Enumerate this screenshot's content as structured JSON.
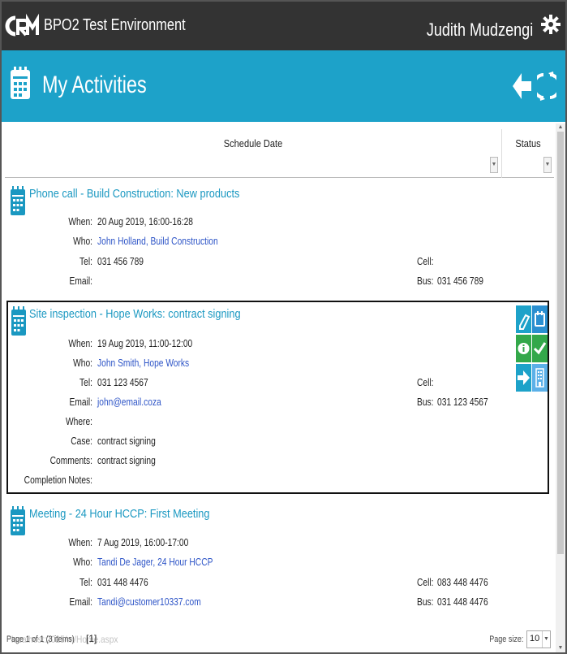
{
  "topbar": {
    "app_title": "BPO2 Test Environment",
    "user_name": "Judith Mudzengi"
  },
  "header": {
    "title": "My Activities"
  },
  "columns": {
    "schedule_date": "Schedule Date",
    "status": "Status",
    "filter_glyph": "▼"
  },
  "labels": {
    "when": "When:",
    "who": "Who:",
    "tel": "Tel:",
    "email": "Email:",
    "cell": "Cell:",
    "bus": "Bus:",
    "where": "Where:",
    "case": "Case:",
    "comments": "Comments:",
    "completion_notes": "Completion Notes:"
  },
  "activities": [
    {
      "title": "Phone call - Build Construction: New products",
      "when": "20 Aug 2019, 16:00-16:28",
      "who": "John Holland, Build Construction",
      "tel": "031 456 789",
      "email": "",
      "cell": "",
      "bus": "031 456 789"
    },
    {
      "title": "Site inspection - Hope Works: contract signing",
      "when": "19 Aug 2019, 11:00-12:00",
      "who": "John Smith, Hope Works",
      "tel": "031 123 4567",
      "email": "john@email.coza",
      "cell": "",
      "bus": "031 123 4567",
      "where": "",
      "case": "contract signing",
      "comments": "contract signing",
      "completion_notes": ""
    },
    {
      "title": "Meeting - 24 Hour HCCP: First Meeting",
      "when": "7 Aug 2019, 16:00-17:00",
      "who": "Tandi De Jager, 24 Hour HCCP",
      "tel": "031 448 4476",
      "email": "Tandi@customer10337.com",
      "cell": "083 448 4476",
      "bus": "031 448 4476"
    }
  ],
  "footer": {
    "pager_text": "Page 1 of 1 (3 items)",
    "current_page": "[1]",
    "url_ghost": "localhost:2025/m/Home.aspx",
    "page_size_label": "Page size:",
    "page_size": "10",
    "dropdown_glyph": "▼"
  },
  "colors": {
    "topbar": "#333333",
    "header": "#1da2c9",
    "title_link": "#1a98c1",
    "link": "#2e55c7",
    "green": "#33a84a"
  },
  "icons": {
    "logo": "crm-logo",
    "gear": "gear-icon",
    "calendar": "calendar-icon",
    "back": "back-arrow-icon",
    "refresh": "refresh-icon",
    "edit": "pencil-icon",
    "schedule": "calendar-icon",
    "info": "info-icon",
    "complete": "check-icon",
    "forward": "arrow-right-icon",
    "building": "building-icon"
  },
  "scrollbar": {
    "up_glyph": "▲",
    "down_glyph": "▼"
  }
}
